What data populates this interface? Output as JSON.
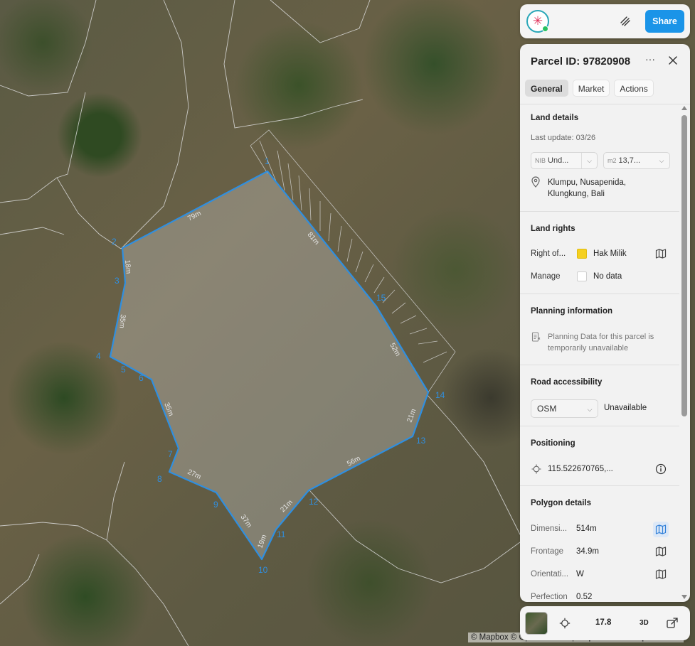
{
  "map": {
    "attribution_prefix": "© Mapbox © OpenStreetMap",
    "attribution_link": "Improve this map © Maxar",
    "vertex_labels": [
      "1",
      "2",
      "3",
      "4",
      "5",
      "6",
      "7",
      "8",
      "9",
      "10",
      "11",
      "12",
      "13",
      "14",
      "15"
    ],
    "segment_labels": [
      "79m",
      "81m",
      "18m",
      "35m",
      "35m",
      "27m",
      "37m",
      "19m",
      "21m",
      "56m",
      "21m",
      "52m"
    ],
    "colors": {
      "parcel_outline": "#2f8fe0",
      "parcel_fill": "rgba(200,200,200,0.35)",
      "boundary_lines": "#dcdcdc"
    }
  },
  "topbar": {
    "logo": "asterisk-logo-icon",
    "layers_icon": "layers-icon",
    "share_label": "Share",
    "colors": {
      "share_bg": "#1a94e8"
    }
  },
  "panel": {
    "title": "Parcel ID: 97820908",
    "more_icon": "ellipsis-icon",
    "close_icon": "close-icon",
    "tabs": [
      {
        "label": "General",
        "active": true
      },
      {
        "label": "Market",
        "active": false
      },
      {
        "label": "Actions",
        "active": false
      }
    ],
    "land_details": {
      "title": "Land details",
      "last_update": "Last update: 03/26",
      "nib_prefix": "NIB",
      "nib_value": "Und...",
      "area_prefix": "m2",
      "area_value": "13,7...",
      "location_icon": "map-pin-icon",
      "address_line1": "Klumpu, Nusapenida,",
      "address_line2": "Klungkung, Bali"
    },
    "land_rights": {
      "title": "Land rights",
      "rows": [
        {
          "label": "Right of...",
          "value": "Hak Milik",
          "swatch": "#f5d020",
          "icon": "map-icon"
        },
        {
          "label": "Manage",
          "value": "No data",
          "swatch": "#ffffff",
          "icon": ""
        }
      ]
    },
    "planning": {
      "title": "Planning information",
      "icon": "document-icon",
      "text_line1": "Planning Data for this parcel is",
      "text_line2": "temporarily unavailable"
    },
    "road": {
      "title": "Road accessibility",
      "select_value": "OSM",
      "status": "Unavailable"
    },
    "positioning": {
      "title": "Positioning",
      "icon": "crosshair-icon",
      "coordinates": "115.522670765,...",
      "info_icon": "info-icon"
    },
    "polygon": {
      "title": "Polygon details",
      "rows": [
        {
          "label": "Dimensi...",
          "value": "514m",
          "icon": "map-icon"
        },
        {
          "label": "Frontage",
          "value": "34.9m",
          "icon": "map-icon"
        },
        {
          "label": "Orientati...",
          "value": "W",
          "icon": "map-icon"
        },
        {
          "label": "Perfection",
          "value": "0.52",
          "icon": ""
        }
      ]
    }
  },
  "bottombar": {
    "thumbnail": "satellite-thumbnail",
    "locate_icon": "crosshair-icon",
    "zoom": "17.8",
    "view_mode": "3D",
    "external_icon": "external-window-icon"
  }
}
